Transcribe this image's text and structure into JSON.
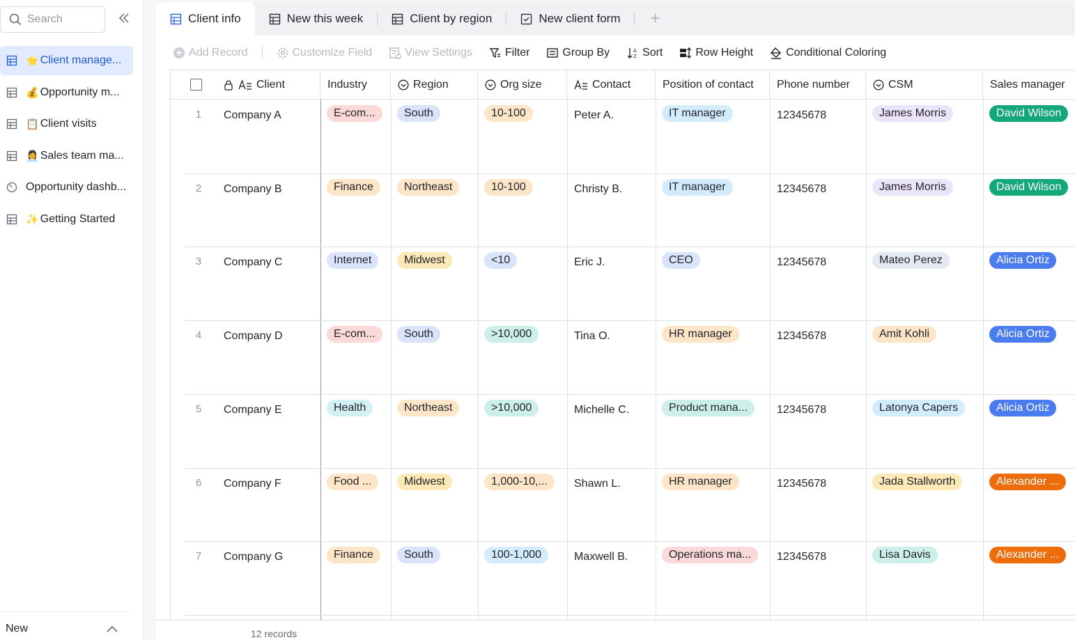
{
  "sidebar": {
    "search_placeholder": "Search",
    "items": [
      {
        "emoji": "⭐",
        "label": "Client manage...",
        "icon": "table-icon",
        "active": true
      },
      {
        "emoji": "💰",
        "label": "Opportunity m...",
        "icon": "table-icon"
      },
      {
        "emoji": "📋",
        "label": "Client visits",
        "icon": "table-icon"
      },
      {
        "emoji": "👩‍💼",
        "label": "Sales team ma...",
        "icon": "table-icon"
      },
      {
        "emoji": "",
        "label": "Opportunity dashb...",
        "icon": "dashboard-icon"
      },
      {
        "emoji": "✨",
        "label": "Getting Started",
        "icon": "table-icon"
      }
    ],
    "footer_label": "New"
  },
  "tabs": [
    {
      "label": "Client info",
      "icon": "grid-view-icon",
      "active": true
    },
    {
      "label": "New this week",
      "icon": "grid-view-icon"
    },
    {
      "label": "Client by region",
      "icon": "grid-view-icon"
    },
    {
      "label": "New client form",
      "icon": "form-view-icon"
    }
  ],
  "toolbar": {
    "add_record": "Add Record",
    "customize_field": "Customize Field",
    "view_settings": "View Settings",
    "filter": "Filter",
    "group_by": "Group By",
    "sort": "Sort",
    "row_height": "Row Height",
    "conditional_coloring": "Conditional Coloring"
  },
  "columns": {
    "client": "Client",
    "industry": "Industry",
    "region": "Region",
    "org_size": "Org size",
    "contact": "Contact",
    "position": "Position of contact",
    "phone": "Phone number",
    "csm": "CSM",
    "sales_manager": "Sales manager"
  },
  "rows": [
    {
      "num": "1",
      "client": "Company A",
      "industry": "E-com...",
      "region": "South",
      "org_size": "10-100",
      "contact": "Peter A.",
      "position": "IT manager",
      "phone": "12345678",
      "csm": "James Morris",
      "sales_manager": "David Wilson"
    },
    {
      "num": "2",
      "client": "Company B",
      "industry": "Finance",
      "region": "Northeast",
      "org_size": "10-100",
      "contact": "Christy B.",
      "position": "IT manager",
      "phone": "12345678",
      "csm": "James Morris",
      "sales_manager": "David Wilson"
    },
    {
      "num": "3",
      "client": "Company C",
      "industry": "Internet",
      "region": "Midwest",
      "org_size": "<10",
      "contact": "Eric J.",
      "position": "CEO",
      "phone": "12345678",
      "csm": "Mateo Perez",
      "sales_manager": "Alicia Ortiz"
    },
    {
      "num": "4",
      "client": "Company D",
      "industry": "E-com...",
      "region": "South",
      "org_size": ">10,000",
      "contact": "Tina O.",
      "position": "HR manager",
      "phone": "12345678",
      "csm": "Amit Kohli",
      "sales_manager": "Alicia Ortiz"
    },
    {
      "num": "5",
      "client": "Company E",
      "industry": "Health",
      "region": "Northeast",
      "org_size": ">10,000",
      "contact": "Michelle C.",
      "position": "Product mana...",
      "phone": "12345678",
      "csm": "Latonya Capers",
      "sales_manager": "Alicia Ortiz"
    },
    {
      "num": "6",
      "client": "Company F",
      "industry": "Food ...",
      "region": "Midwest",
      "org_size": "1,000-10,...",
      "contact": "Shawn L.",
      "position": "HR manager",
      "phone": "12345678",
      "csm": "Jada Stallworth",
      "sales_manager": "Alexander ..."
    },
    {
      "num": "7",
      "client": "Company G",
      "industry": "Finance",
      "region": "South",
      "org_size": "100-1,000",
      "contact": "Maxwell B.",
      "position": "Operations ma...",
      "phone": "12345678",
      "csm": "Lisa Davis",
      "sales_manager": "Alexander ..."
    }
  ],
  "footer": {
    "records": "12 records"
  },
  "colors": {
    "E-com...": "#fcd9d9",
    "Finance": "#fde5c8",
    "Internet": "#d9e4fb",
    "Health": "#d3f0f5",
    "Food ...": "#fde5c8",
    "South": "#d9e4fb",
    "Northeast": "#fde5c8",
    "Midwest": "#fde9b8",
    "10-100": "#fde5c8",
    "<10": "#d9e4fb",
    ">10,000": "#cdefe9",
    "1,000-10,...": "#fde5c8",
    "100-1,000": "#d3ecfb",
    "IT manager": "#d3ecfb",
    "CEO": "#d9e4fb",
    "HR manager": "#fde5c8",
    "Product mana...": "#cdefe9",
    "Operations ma...": "#fcd9d9",
    "James Morris": "#ece4f9",
    "Mateo Perez": "#e4e9f2",
    "Amit Kohli": "#fde5c8",
    "Latonya Capers": "#d3ecfb",
    "Jada Stallworth": "#fde9b8",
    "Lisa Davis": "#cdefe9",
    "David Wilson": "#14a77a",
    "Alicia Ortiz": "#4a7cf0",
    "Alexander ...": "#ed6c0c"
  }
}
